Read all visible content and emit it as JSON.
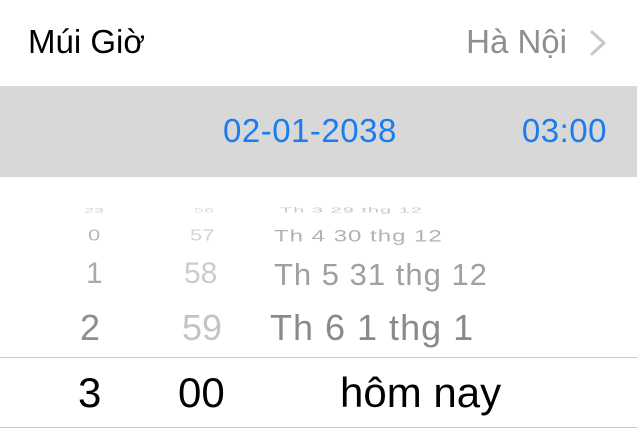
{
  "timezone": {
    "label": "Múi Giờ",
    "value": "Hà Nội"
  },
  "summary": {
    "date": "02-01-2038",
    "time": "03:00"
  },
  "picker": {
    "hours": [
      "0",
      "1",
      "2",
      "3"
    ],
    "minutes": [
      "57",
      "58",
      "59",
      "00"
    ],
    "days": [
      "Th 3 29 thg 12",
      "Th 4 30 thg 12",
      "Th 5 31 thg 12",
      "Th 6 1 thg 1",
      "hôm nay"
    ],
    "hours_top_partial": "23",
    "minutes_top_partial": "56"
  },
  "colors": {
    "accent": "#1a7cf0",
    "secondary_text": "#8e8e93",
    "summary_bg": "#d8d8d8"
  }
}
